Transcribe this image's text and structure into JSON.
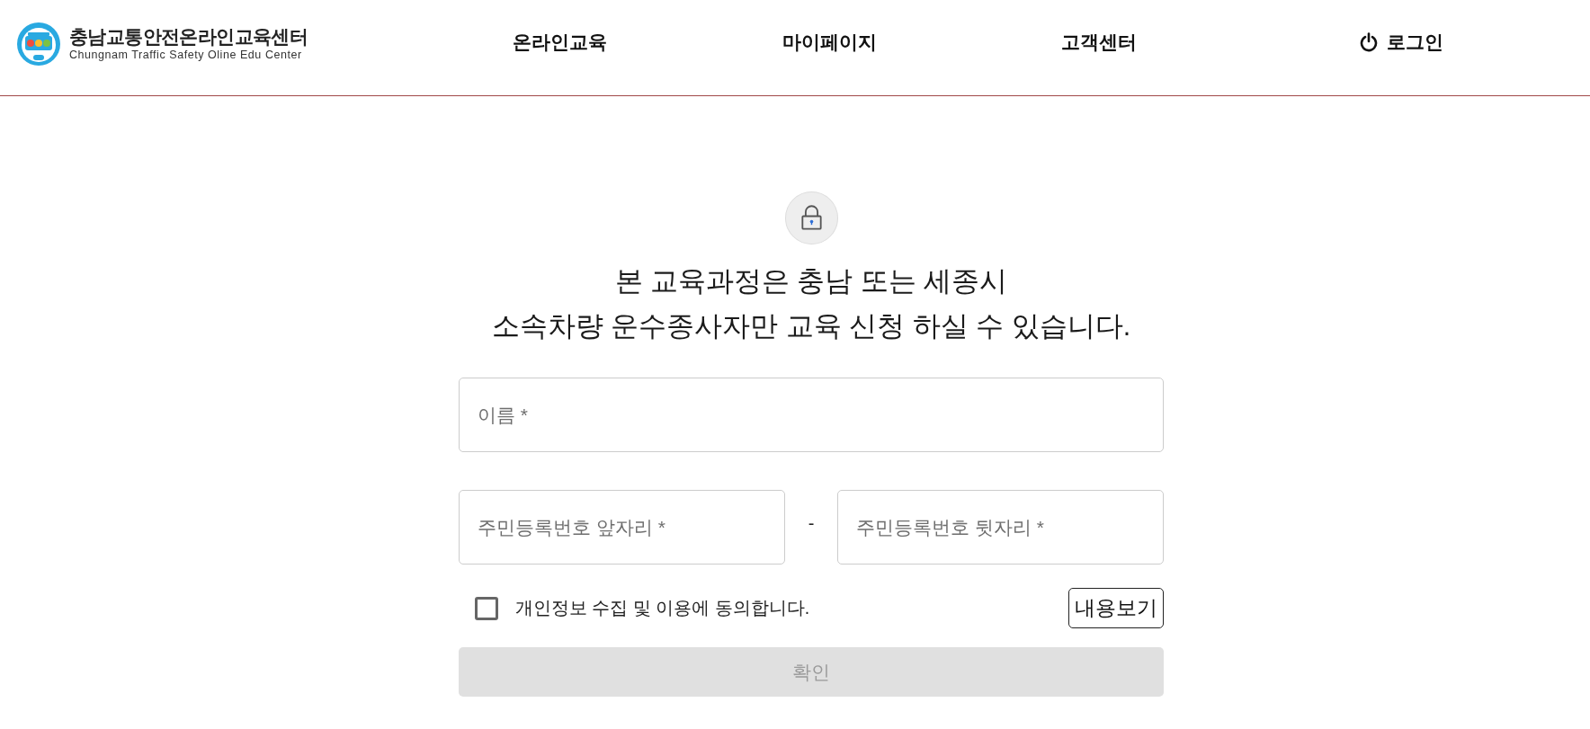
{
  "header": {
    "logo": {
      "title": "충남교통안전온라인교육센터",
      "subtitle": "Chungnam Traffic Safety Oline Edu Center"
    },
    "nav": [
      {
        "label": "온라인교육",
        "kind": "link"
      },
      {
        "label": "마이페이지",
        "kind": "link"
      },
      {
        "label": "고객센터",
        "kind": "link"
      },
      {
        "label": "로그인",
        "kind": "login"
      }
    ]
  },
  "notice": {
    "lines": [
      "본 교육과정은 충남 또는 세종시",
      "소속차량 운수종사자만 교육 신청 하실 수 있습니다."
    ]
  },
  "form": {
    "name_field": {
      "placeholder": "이름 *"
    },
    "ssn": {
      "front": {
        "placeholder": "주민등록번호 앞자리 *"
      },
      "separator": "-",
      "back": {
        "placeholder": "주민등록번호 뒷자리 *"
      }
    },
    "consent": {
      "label": "개인정보 수집 및 이용에 동의합니다.",
      "checked": false,
      "view_button": "내용보기"
    },
    "submit": {
      "label": "확인",
      "disabled": true
    }
  }
}
